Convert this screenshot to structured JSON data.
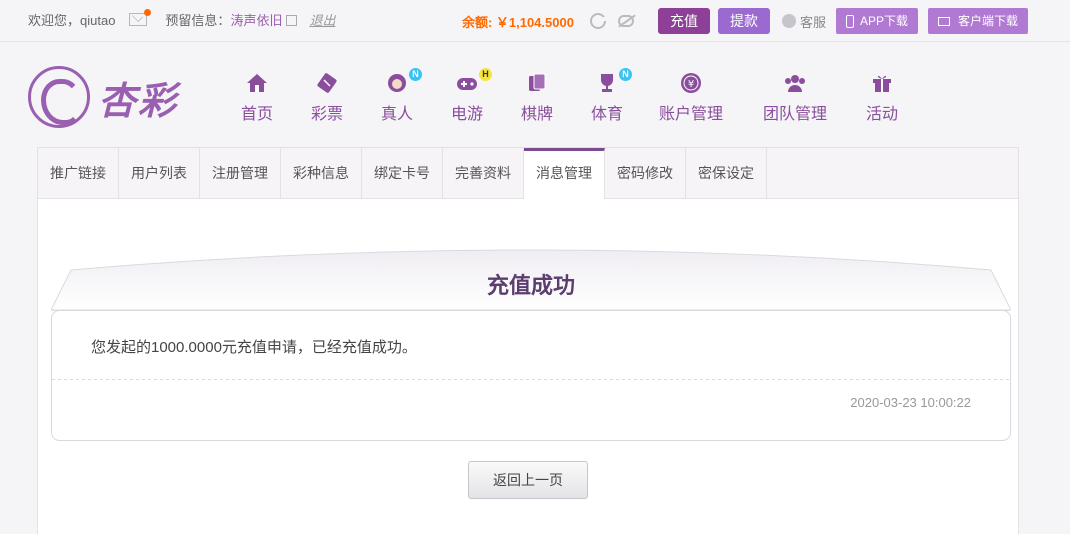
{
  "topbar": {
    "welcome": "欢迎您，qiutao",
    "reserve_label": "预留信息：",
    "reserve_value": "涛声依旧",
    "logout": "退出",
    "balance": "余额: ￥1,104.5000",
    "recharge": "充值",
    "withdraw": "提款",
    "service": "客服",
    "app_download": "APP下载",
    "client_download": "客户端下载"
  },
  "brand": {
    "name": "杏彩"
  },
  "nav": [
    {
      "label": "首页",
      "icon": "home-icon"
    },
    {
      "label": "彩票",
      "icon": "ticket-icon"
    },
    {
      "label": "真人",
      "icon": "dealer-icon",
      "badge": "N"
    },
    {
      "label": "电游",
      "icon": "gamepad-icon",
      "badge": "H"
    },
    {
      "label": "棋牌",
      "icon": "cards-icon"
    },
    {
      "label": "体育",
      "icon": "trophy-icon",
      "badge": "N"
    },
    {
      "label": "账户管理",
      "icon": "yen-icon"
    },
    {
      "label": "团队管理",
      "icon": "team-icon"
    },
    {
      "label": "活动",
      "icon": "gift-icon"
    }
  ],
  "tabs": [
    "推广链接",
    "用户列表",
    "注册管理",
    "彩种信息",
    "绑定卡号",
    "完善资料",
    "消息管理",
    "密码修改",
    "密保设定"
  ],
  "active_tab": 6,
  "message": {
    "title": "充值成功",
    "body": "您发起的1000.0000元充值申请，已经充值成功。",
    "date": "2020-03-23 10:00:22"
  },
  "back_button": "返回上一页",
  "colors": {
    "brand": "#8e3f97",
    "accent": "#ff6a00",
    "nav": "#8a4e9c"
  }
}
